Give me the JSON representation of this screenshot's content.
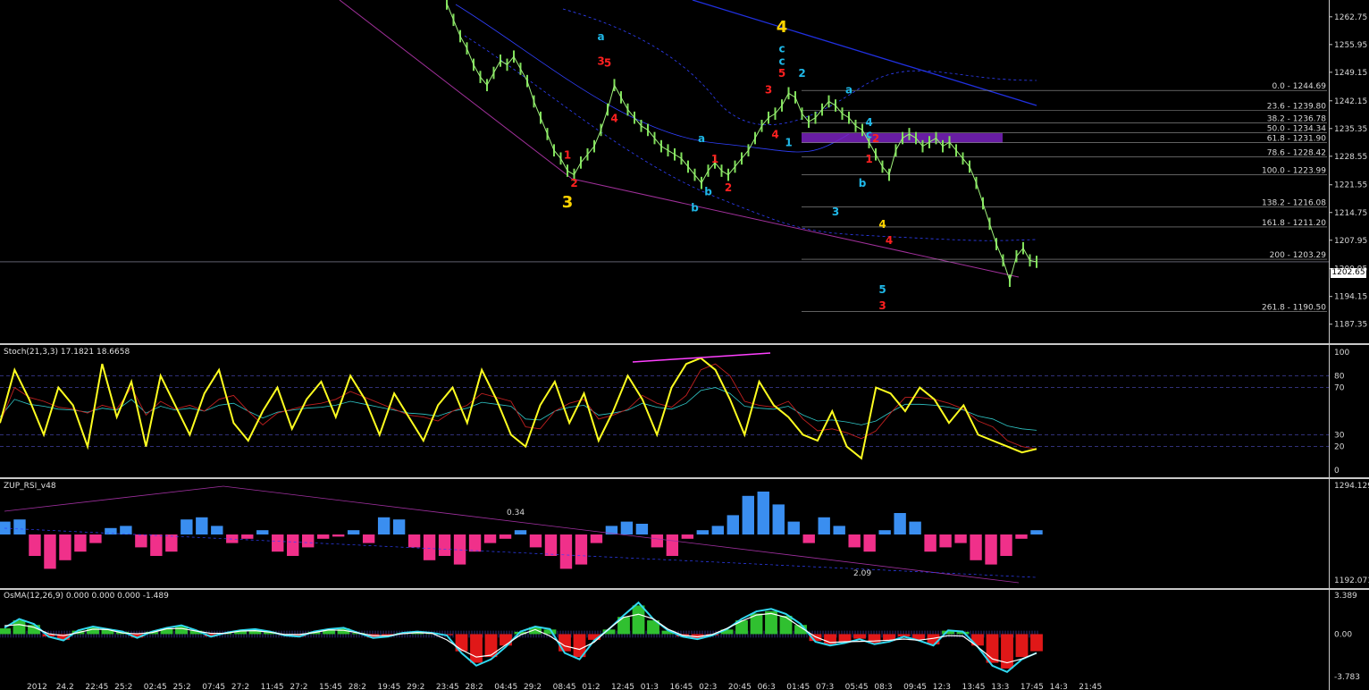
{
  "chart_data": [
    {
      "type": "line",
      "name": "main",
      "ylim": [
        1184.0,
        1266.0
      ],
      "y_ticks": [
        "1262.75",
        "1255.95",
        "1249.15",
        "1242.15",
        "1235.35",
        "1228.55",
        "1221.55",
        "1214.75",
        "1207.95",
        "1200.95",
        "1194.15",
        "1187.35"
      ],
      "current_price": "1202.65",
      "fib_levels": [
        {
          "label": "0.0 - 1244.69",
          "value": 1244.69
        },
        {
          "label": "23.6 - 1239.80",
          "value": 1239.8
        },
        {
          "label": "38.2 - 1236.78",
          "value": 1236.78
        },
        {
          "label": "50.0 - 1234.34",
          "value": 1234.34
        },
        {
          "label": "61.8 - 1231.90",
          "value": 1231.9
        },
        {
          "label": "78.6 - 1228.42",
          "value": 1228.42
        },
        {
          "label": "100.0 - 1223.99",
          "value": 1223.99
        },
        {
          "label": "138.2 - 1216.08",
          "value": 1216.08
        },
        {
          "label": "161.8 - 1211.20",
          "value": 1211.2
        },
        {
          "label": "200 - 1203.29",
          "value": 1203.29
        },
        {
          "label": "261.8 - 1190.50",
          "value": 1190.5
        }
      ],
      "series": [
        {
          "values": [
            1266,
            1262,
            1258,
            1255,
            1251,
            1248,
            1246,
            1249,
            1252,
            1251,
            1253,
            1250,
            1247,
            1242,
            1238,
            1234,
            1230,
            1228,
            1225,
            1224,
            1227,
            1229,
            1231,
            1235,
            1240,
            1246,
            1243,
            1240,
            1238,
            1236,
            1235,
            1233,
            1231,
            1230,
            1229,
            1228,
            1226,
            1224,
            1222,
            1225,
            1227,
            1225,
            1224,
            1226,
            1228,
            1230,
            1233,
            1236,
            1238,
            1239,
            1241,
            1244,
            1243,
            1239,
            1237,
            1238,
            1240,
            1242,
            1241,
            1239,
            1238,
            1236,
            1235,
            1232,
            1229,
            1226,
            1224,
            1230,
            1233,
            1234,
            1233,
            1231,
            1232,
            1233,
            1231,
            1232,
            1230,
            1228,
            1226,
            1222,
            1217,
            1212,
            1207,
            1203,
            1198,
            1204,
            1206,
            1203,
            1202.65
          ]
        }
      ],
      "wave_labels": [
        {
          "text": "a",
          "color": "#1fb8e8",
          "i": 23,
          "v": 1257
        },
        {
          "text": "3",
          "color": "#ff2020",
          "i": 23,
          "v": 1251
        },
        {
          "text": "5",
          "color": "#ff2020",
          "i": 24,
          "v": 1250.5
        },
        {
          "text": "4",
          "color": "#ff2020",
          "i": 25,
          "v": 1237
        },
        {
          "text": "1",
          "color": "#ff2020",
          "i": 18,
          "v": 1228
        },
        {
          "text": "2",
          "color": "#ff2020",
          "i": 19,
          "v": 1221
        },
        {
          "text": "3",
          "color": "#ffd400",
          "i": 18,
          "v": 1216
        },
        {
          "text": "b",
          "color": "#1fb8e8",
          "i": 37,
          "v": 1215
        },
        {
          "text": "a",
          "color": "#1fb8e8",
          "i": 38,
          "v": 1232
        },
        {
          "text": "b",
          "color": "#1fb8e8",
          "i": 39,
          "v": 1219
        },
        {
          "text": "1",
          "color": "#ff2020",
          "i": 40,
          "v": 1227
        },
        {
          "text": "2",
          "color": "#ff2020",
          "i": 42,
          "v": 1220
        },
        {
          "text": "3",
          "color": "#ff2020",
          "i": 48,
          "v": 1244
        },
        {
          "text": "4",
          "color": "#ff2020",
          "i": 49,
          "v": 1233
        },
        {
          "text": "4",
          "color": "#ffd400",
          "i": 50,
          "v": 1259
        },
        {
          "text": "c",
          "color": "#1fb8e8",
          "i": 50,
          "v": 1254
        },
        {
          "text": "c",
          "color": "#1fb8e8",
          "i": 50,
          "v": 1251
        },
        {
          "text": "5",
          "color": "#ff2020",
          "i": 50,
          "v": 1248
        },
        {
          "text": "1",
          "color": "#1fb8e8",
          "i": 51,
          "v": 1231
        },
        {
          "text": "2",
          "color": "#1fb8e8",
          "i": 53,
          "v": 1248
        },
        {
          "text": "3",
          "color": "#1fb8e8",
          "i": 58,
          "v": 1214
        },
        {
          "text": "a",
          "color": "#1fb8e8",
          "i": 60,
          "v": 1244
        },
        {
          "text": "4",
          "color": "#1fb8e8",
          "i": 63,
          "v": 1236
        },
        {
          "text": "c",
          "color": "#1fb8e8",
          "i": 63,
          "v": 1233
        },
        {
          "text": "2",
          "color": "#ff2020",
          "i": 64,
          "v": 1232
        },
        {
          "text": "b",
          "color": "#1fb8e8",
          "i": 62,
          "v": 1221
        },
        {
          "text": "1",
          "color": "#ff2020",
          "i": 63,
          "v": 1227
        },
        {
          "text": "4",
          "color": "#ffd400",
          "i": 65,
          "v": 1211
        },
        {
          "text": "4",
          "color": "#ff2020",
          "i": 66,
          "v": 1207
        },
        {
          "text": "5",
          "color": "#1fb8e8",
          "i": 65,
          "v": 1195
        },
        {
          "text": "3",
          "color": "#ff2020",
          "i": 65,
          "v": 1191
        }
      ]
    },
    {
      "type": "line",
      "name": "Stoch",
      "label": "Stoch(21,3,3) 17.1821 18.6658",
      "ylim": [
        0,
        100
      ],
      "y_ticks": [
        "100",
        "80",
        "70",
        "30",
        "20",
        "0"
      ],
      "series": [
        {
          "values": [
            40,
            85,
            60,
            30,
            70,
            55,
            20,
            90,
            45,
            75,
            20,
            80,
            55,
            30,
            65,
            85,
            40,
            25,
            50,
            70,
            35,
            60,
            75,
            45,
            80,
            60,
            30,
            65,
            45,
            25,
            55,
            70,
            40,
            85,
            60,
            30,
            20,
            55,
            75,
            40,
            65,
            25,
            50,
            80,
            60,
            30,
            70,
            90,
            95,
            85,
            60,
            30,
            75,
            55,
            45,
            30,
            25,
            50,
            20,
            10,
            70,
            65,
            50,
            70,
            60,
            40,
            55,
            30,
            25,
            20,
            15,
            18
          ]
        }
      ]
    },
    {
      "type": "bar",
      "name": "ZUP_RSI_v48",
      "label": "ZUP_RSI_v48",
      "ylim": [
        -1.0,
        1.0
      ],
      "y_ticks": [
        "1294.129",
        "1192.071"
      ],
      "annotations": [
        "0.34",
        "2.09"
      ],
      "series": [
        {
          "values": [
            0.3,
            0.35,
            -0.5,
            -0.8,
            -0.6,
            -0.4,
            -0.2,
            0.15,
            0.2,
            -0.3,
            -0.5,
            -0.4,
            0.35,
            0.4,
            0.2,
            -0.2,
            -0.1,
            0.1,
            -0.4,
            -0.5,
            -0.3,
            -0.1,
            -0.05,
            0.1,
            -0.2,
            0.4,
            0.35,
            -0.3,
            -0.6,
            -0.5,
            -0.7,
            -0.4,
            -0.2,
            -0.1,
            0.1,
            -0.3,
            -0.5,
            -0.8,
            -0.7,
            -0.2,
            0.2,
            0.3,
            0.25,
            -0.3,
            -0.5,
            -0.1,
            0.1,
            0.2,
            0.45,
            0.9,
            1.0,
            0.7,
            0.3,
            -0.2,
            0.4,
            0.2,
            -0.3,
            -0.4,
            0.1,
            0.5,
            0.3,
            -0.4,
            -0.3,
            -0.2,
            -0.6,
            -0.7,
            -0.5,
            -0.1,
            0.1
          ]
        }
      ]
    },
    {
      "type": "bar",
      "name": "OsMA",
      "label": "OsMA(12,26,9) 0.000 0.000 0.000 -1.489",
      "ylim": [
        -3.783,
        3.389
      ],
      "y_ticks": [
        "3.389",
        "0.00",
        "-3.783"
      ],
      "series": [
        {
          "values": [
            0.5,
            1.2,
            0.8,
            -0.2,
            -0.5,
            0.3,
            0.6,
            0.4,
            0.2,
            -0.3,
            0.2,
            0.5,
            0.7,
            0.3,
            -0.2,
            0.1,
            0.3,
            0.4,
            0.2,
            -0.1,
            -0.2,
            0.2,
            0.4,
            0.5,
            0.1,
            -0.3,
            -0.2,
            0.1,
            0.2,
            0.1,
            -0.1,
            -1.5,
            -2.5,
            -2.0,
            -1.0,
            0.2,
            0.6,
            0.4,
            -1.5,
            -2.0,
            -0.5,
            0.4,
            1.5,
            2.5,
            1.2,
            0.3,
            -0.2,
            -0.4,
            -0.1,
            0.4,
            1.2,
            1.8,
            2.0,
            1.6,
            0.8,
            -0.6,
            -0.9,
            -0.7,
            -0.4,
            -0.8,
            -0.6,
            -0.2,
            -0.5,
            -0.9,
            0.3,
            0.2,
            -1.0,
            -2.5,
            -3.0,
            -2.0,
            -1.489
          ]
        }
      ]
    }
  ],
  "x_axis_labels": [
    "2012",
    "24.2",
    "22:45",
    "25:2",
    "02:45",
    "25:2",
    "07:45",
    "27:2",
    "11:45",
    "27:2",
    "15:45",
    "28:2",
    "19:45",
    "29:2",
    "23:45",
    "28:2",
    "04:45",
    "29:2",
    "08:45",
    "01:2",
    "12:45",
    "01:3",
    "16:45",
    "02:3",
    "20:45",
    "06:3",
    "01:45",
    "07:3",
    "05:45",
    "08:3",
    "09:45",
    "12:3",
    "13:45",
    "13:3",
    "17:45",
    "14:3",
    "21:45"
  ]
}
